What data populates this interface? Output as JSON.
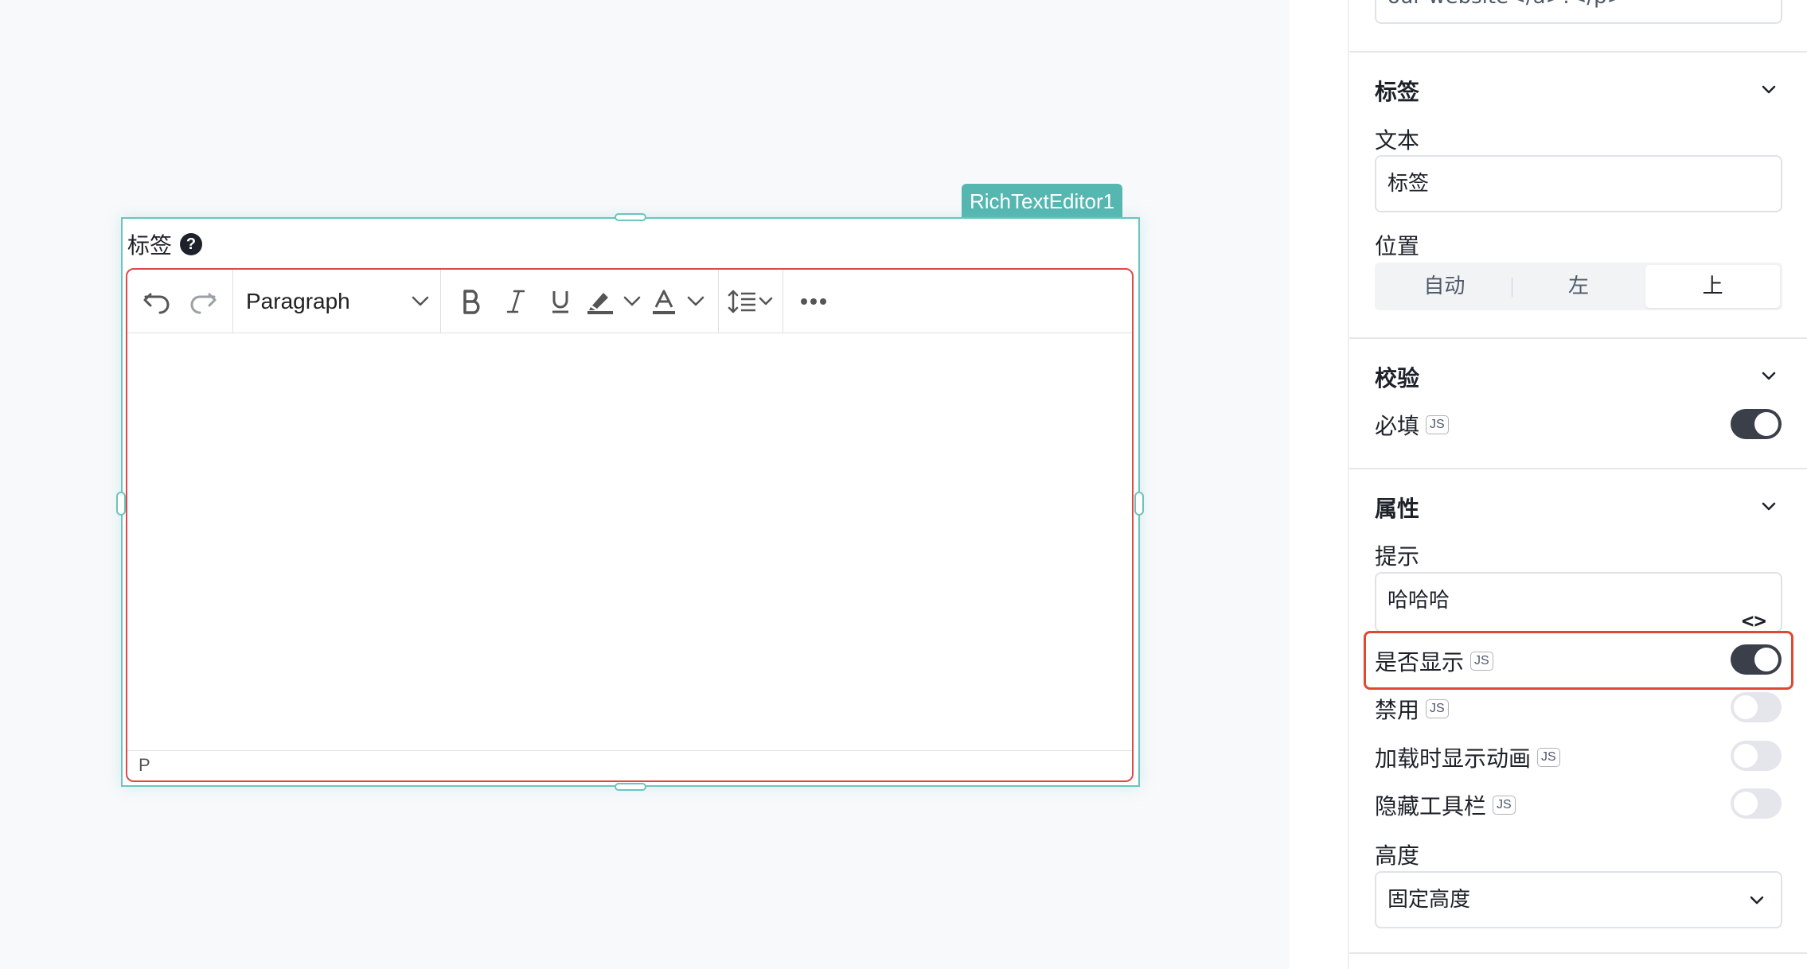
{
  "canvas": {
    "component_name": "RichTextEditor1",
    "field_label": "标签",
    "help_icon": "?",
    "toolbar": {
      "undo_icon": "undo-icon",
      "redo_icon": "redo-icon",
      "block_format": "Paragraph",
      "more_icon": "more-icon"
    },
    "status_path": "P"
  },
  "panel": {
    "top_input_value": "our website</a>.</p>",
    "label_section": {
      "title": "标签",
      "text_label": "文本",
      "text_value": "标签",
      "position_label": "位置",
      "position_options": [
        "自动",
        "左",
        "上"
      ],
      "position_selected": "上"
    },
    "validation_section": {
      "title": "校验",
      "required_label": "必填",
      "required_on": true
    },
    "properties_section": {
      "title": "属性",
      "tooltip_label": "提示",
      "tooltip_value": "哈哈哈",
      "code_icon": "<>",
      "visible_label": "是否显示",
      "visible_on": true,
      "disabled_label": "禁用",
      "disabled_on": false,
      "loading_anim_label": "加载时显示动画",
      "loading_anim_on": false,
      "hide_toolbar_label": "隐藏工具栏",
      "hide_toolbar_on": false,
      "height_label": "高度",
      "height_value": "固定高度"
    },
    "js_badge": "JS"
  },
  "colors": {
    "accent_teal": "#56b7b1",
    "error_red": "#e04848",
    "highlight_red": "#e0492f",
    "toggle_on": "#3a3f4a"
  }
}
